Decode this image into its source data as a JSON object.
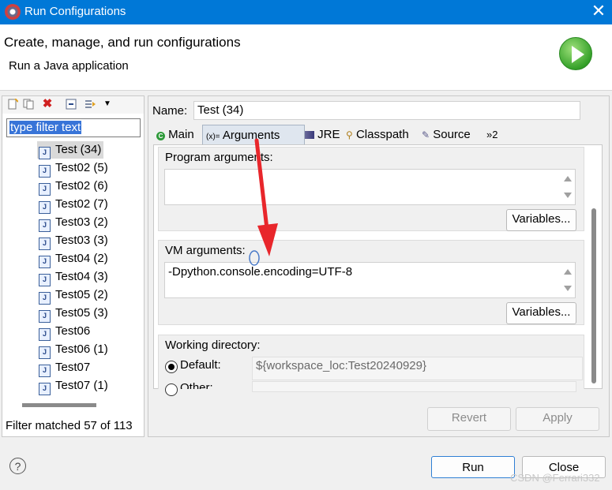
{
  "window": {
    "title": "Run Configurations",
    "close_glyph": "✕"
  },
  "header": {
    "title": "Create, manage, and run configurations",
    "subtitle": "Run a Java application"
  },
  "left": {
    "filter_placeholder": "type filter text",
    "items": [
      "Test (34)",
      "Test02 (5)",
      "Test02 (6)",
      "Test02 (7)",
      "Test03 (2)",
      "Test03 (3)",
      "Test04 (2)",
      "Test04 (3)",
      "Test05 (2)",
      "Test05 (3)",
      "Test06",
      "Test06 (1)",
      "Test07",
      "Test07 (1)"
    ],
    "selected_index": 0,
    "status": "Filter matched 57 of 113"
  },
  "config": {
    "name_label": "Name:",
    "name_value": "Test (34)",
    "tabs": [
      "Main",
      "Arguments",
      "JRE",
      "Classpath",
      "Source"
    ],
    "tab_icons": [
      "main-tab-icon",
      "arguments-tab-icon",
      "jre-tab-icon",
      "classpath-tab-icon",
      "source-tab-icon"
    ],
    "more_tabs": "»2",
    "active_tab": 1,
    "program_args_label": "Program arguments:",
    "program_args_value": "",
    "variables_label": "Variables...",
    "vm_args_label": "VM arguments:",
    "vm_args_value": "-Dpython.console.encoding=UTF-8",
    "working_dir_label": "Working directory:",
    "default_label": "Default:",
    "default_value": "${workspace_loc:Test20240929}",
    "other_label": "Other:"
  },
  "actions": {
    "revert": "Revert",
    "apply": "Apply",
    "run": "Run",
    "close": "Close",
    "help": "?"
  },
  "watermark": "CSDN @Ferrari332",
  "colors": {
    "titlebar": "#0078d7",
    "selection": "#3874d8",
    "arrow": "#e8262b"
  }
}
